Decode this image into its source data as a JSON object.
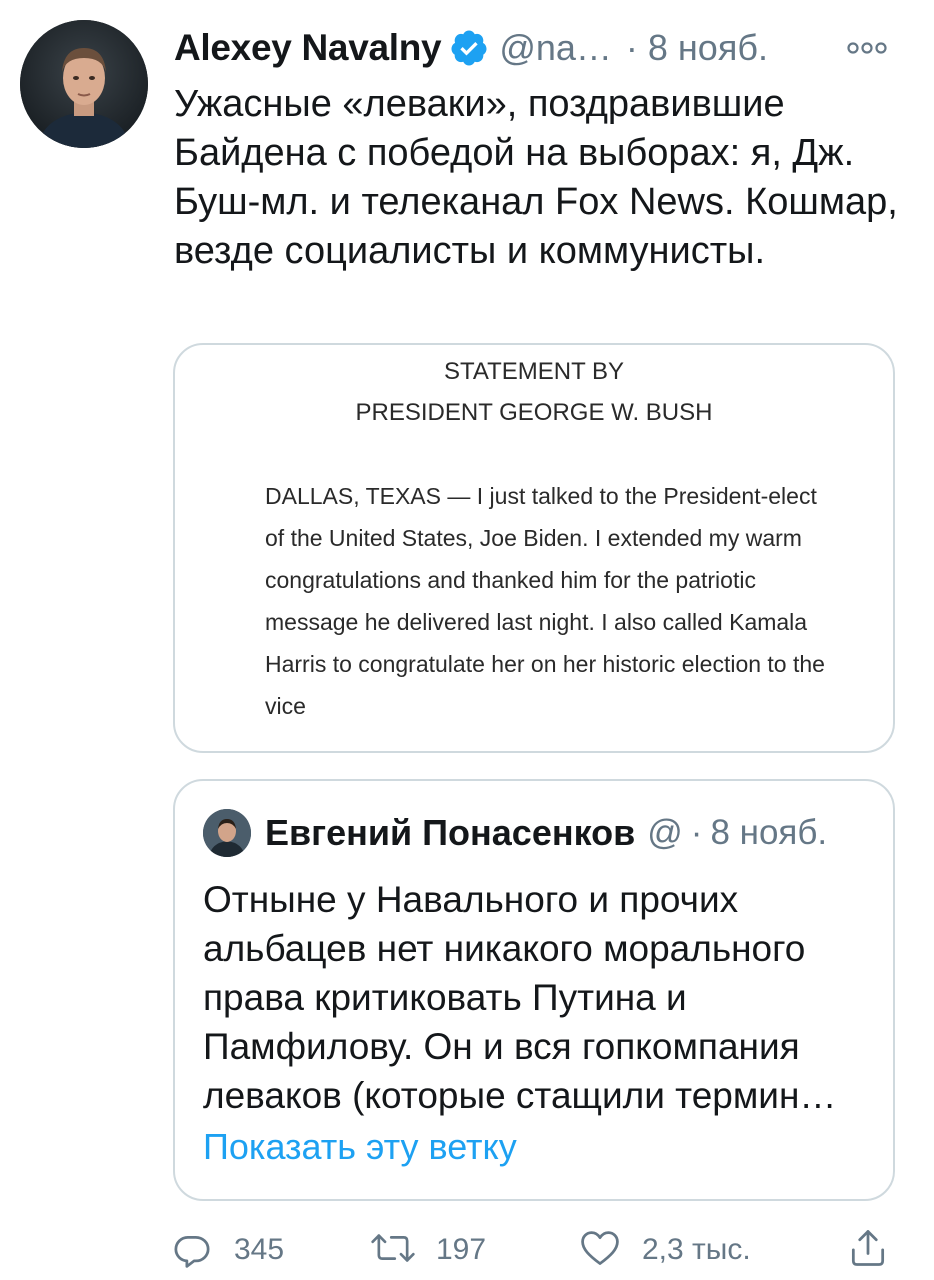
{
  "tweet": {
    "author_name": "Alexey Navalny",
    "handle": "@na…",
    "separator": "·",
    "date": "8 нояб.",
    "text": "Ужасные «леваки», поздравившие Байдена с победой на выборах: я, Дж. Буш-мл. и телеканал Fox News. Кошмар, везде социалисты и коммунисты."
  },
  "media": {
    "title_line1": "STATEMENT BY",
    "title_line2": "PRESIDENT GEORGE W. BUSH",
    "body": "DALLAS, TEXAS — I just talked to the President-elect of the United States, Joe Biden. I extended my warm congratulations and thanked him for the patriotic message he delivered last night. I also called Kamala Harris to congratulate her on her historic election to the vice"
  },
  "quote": {
    "author_name": "Евгений Понасенков",
    "handle": "@",
    "separator": "·",
    "date": "8 нояб.",
    "text": "Отныне у Навального и прочих альбацев нет никакого морального права критиковать Путина и Памфилову. Он и вся гопкомпания леваков (которые стащили термин…",
    "show_thread": "Показать эту ветку"
  },
  "actions": {
    "replies": "345",
    "retweets": "197",
    "likes": "2,3 тыс."
  },
  "colors": {
    "text": "#14171a",
    "secondary": "#657786",
    "accent": "#1da1f2",
    "border": "#cfd9de"
  },
  "icons": {
    "verified": "verified-badge-icon",
    "more": "more-options-icon",
    "reply": "reply-icon",
    "retweet": "retweet-icon",
    "like": "heart-icon",
    "share": "share-icon"
  }
}
